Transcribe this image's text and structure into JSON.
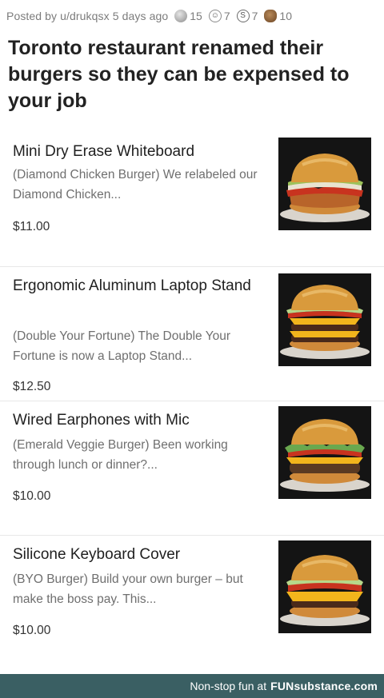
{
  "post": {
    "meta": "Posted by u/drukqsx 5 days ago",
    "awards": [
      {
        "icon": "silver-award-icon",
        "count": "15"
      },
      {
        "icon": "wholesome-award-icon",
        "count": "7"
      },
      {
        "icon": "helpful-award-icon",
        "count": "7"
      },
      {
        "icon": "poop-award-icon",
        "count": "10"
      }
    ],
    "title": "Toronto restaurant renamed their burgers so they can be expensed to your job"
  },
  "menu": {
    "items": [
      {
        "name": "Mini Dry Erase Whiteboard",
        "description": "(Diamond Chicken Burger) We relabeled our Diamond Chicken...",
        "price": "$11.00",
        "image": "chicken-burger"
      },
      {
        "name": "Ergonomic Aluminum Laptop Stand",
        "description": "(Double Your Fortune) The Double Your Fortune is now a Laptop Stand...",
        "price": "$12.50",
        "image": "double-burger"
      },
      {
        "name": "Wired Earphones with Mic",
        "description": "(Emerald Veggie Burger) Been working through lunch or dinner?...",
        "price": "$10.00",
        "image": "veggie-burger"
      },
      {
        "name": "Silicone Keyboard Cover",
        "description": "(BYO Burger) Build your own burger – but make the boss pay. This...",
        "price": "$10.00",
        "image": "byo-burger"
      }
    ]
  },
  "footer": {
    "text": "Non-stop fun at",
    "brand": "FUNsubstance.com"
  },
  "colors": {
    "footer_bg": "#3a5f63",
    "bun": "#d99a3c",
    "lettuce": "#9cc25a",
    "tomato": "#c8331f",
    "cheese": "#f2b51c",
    "patty": "#4a2a1a"
  }
}
